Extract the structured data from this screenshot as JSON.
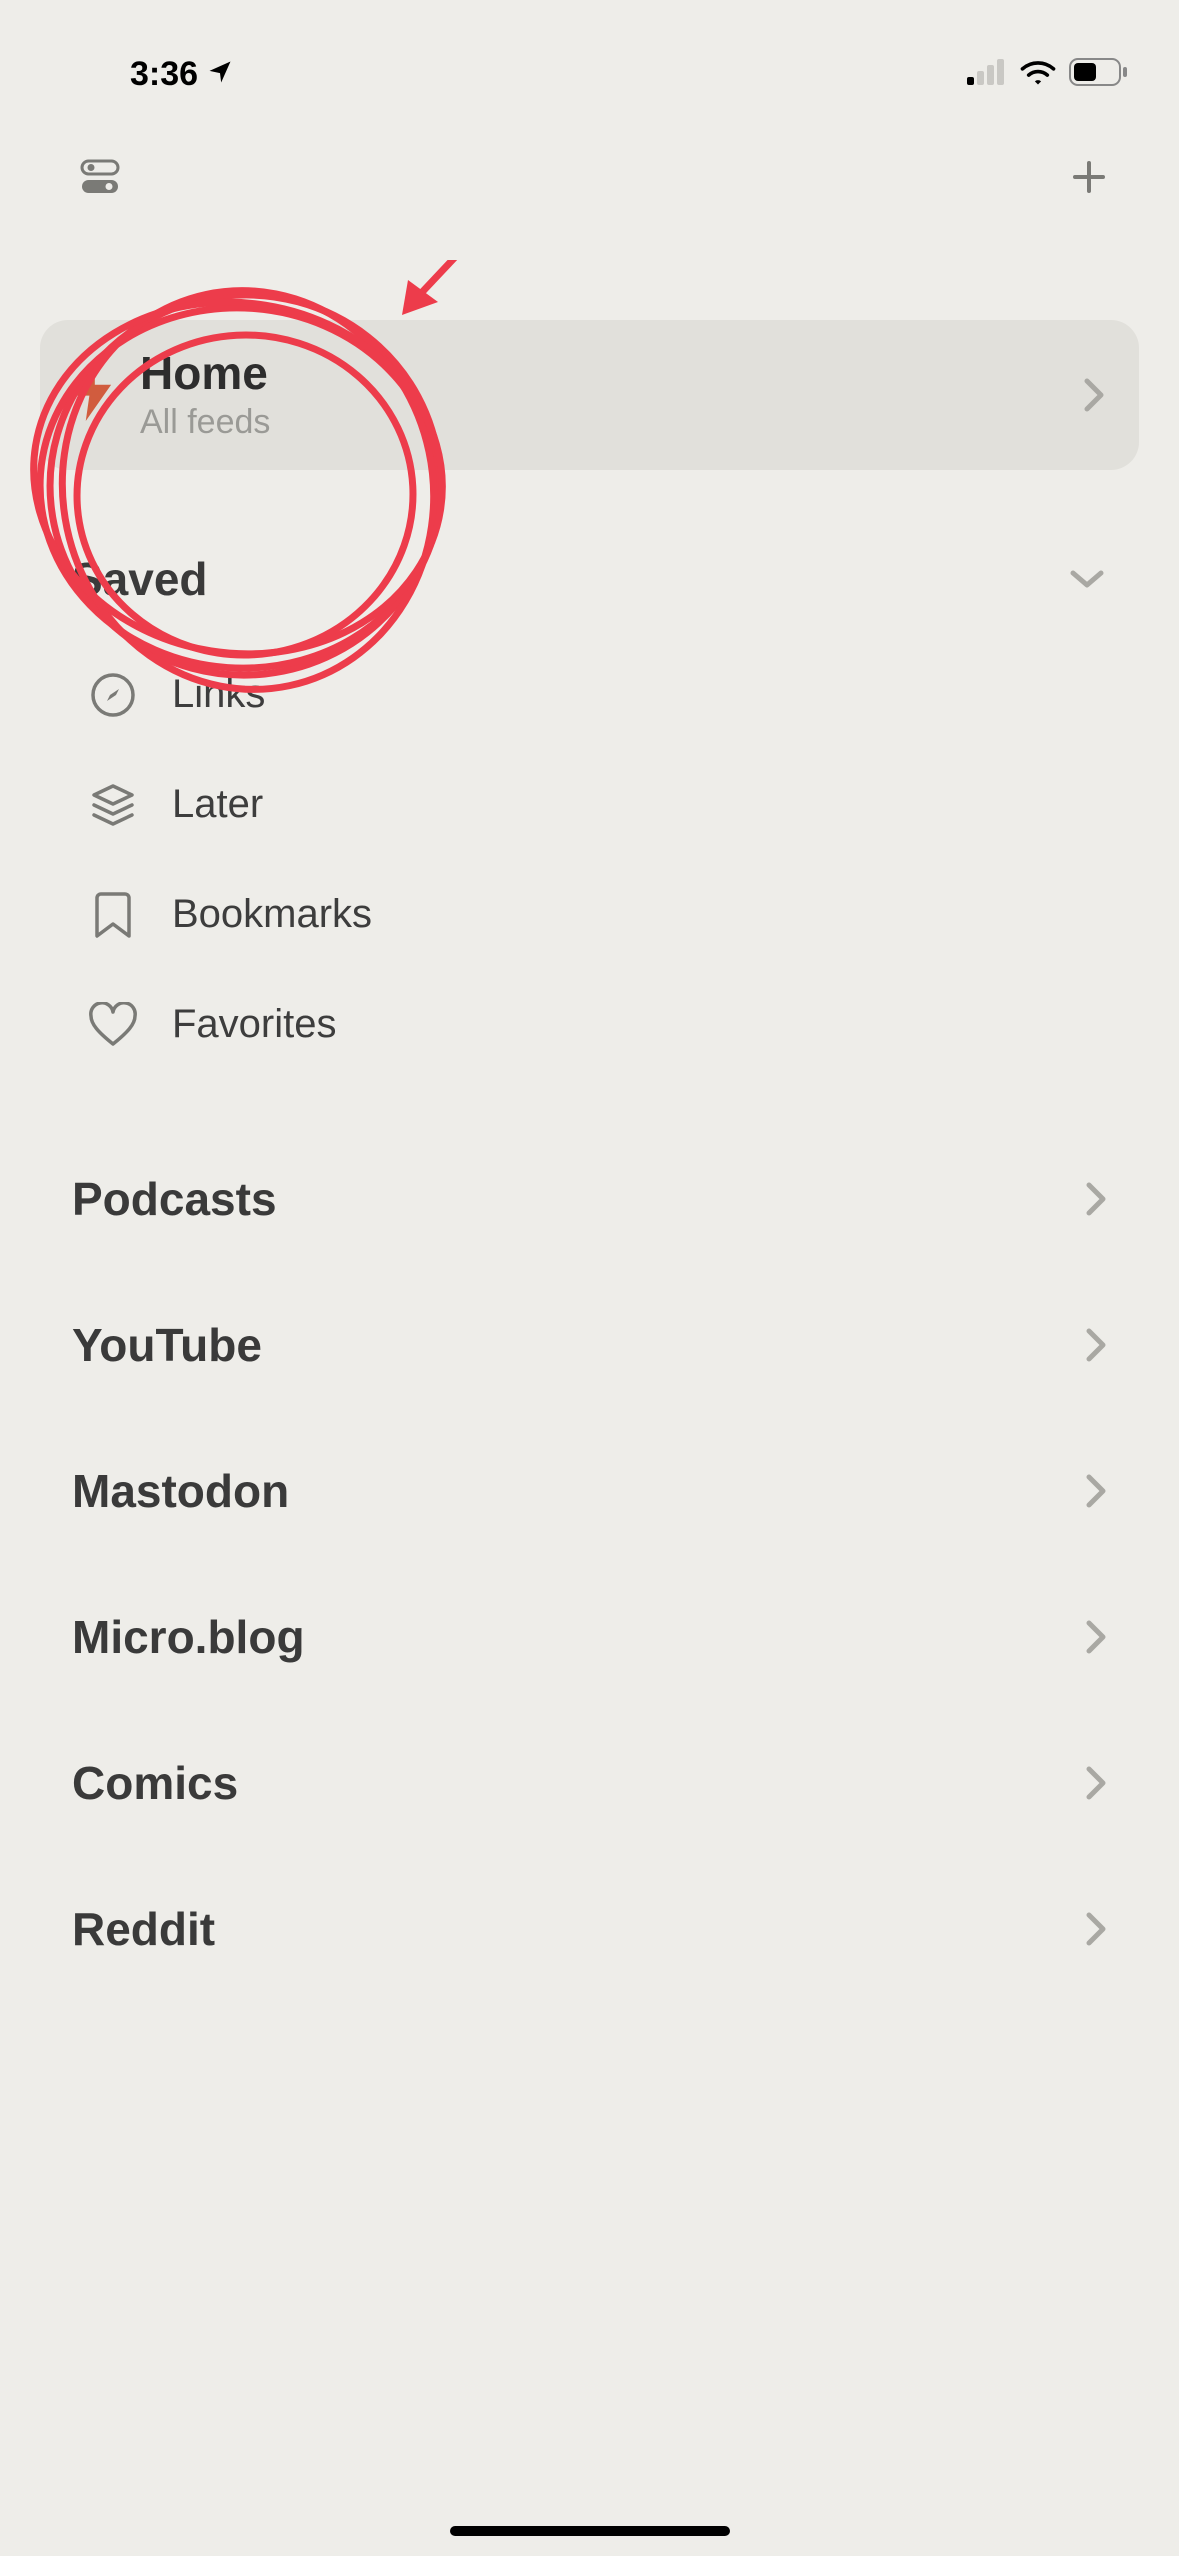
{
  "status": {
    "time": "3:36"
  },
  "home": {
    "title": "Home",
    "subtitle": "All feeds"
  },
  "saved": {
    "title": "Saved",
    "items": [
      {
        "label": "Links"
      },
      {
        "label": "Later"
      },
      {
        "label": "Bookmarks"
      },
      {
        "label": "Favorites"
      }
    ]
  },
  "sections": [
    {
      "label": "Podcasts"
    },
    {
      "label": "YouTube"
    },
    {
      "label": "Mastodon"
    },
    {
      "label": "Micro.blog"
    },
    {
      "label": "Comics"
    },
    {
      "label": "Reddit"
    }
  ],
  "annotation": {
    "color": "#ed3c4b"
  }
}
